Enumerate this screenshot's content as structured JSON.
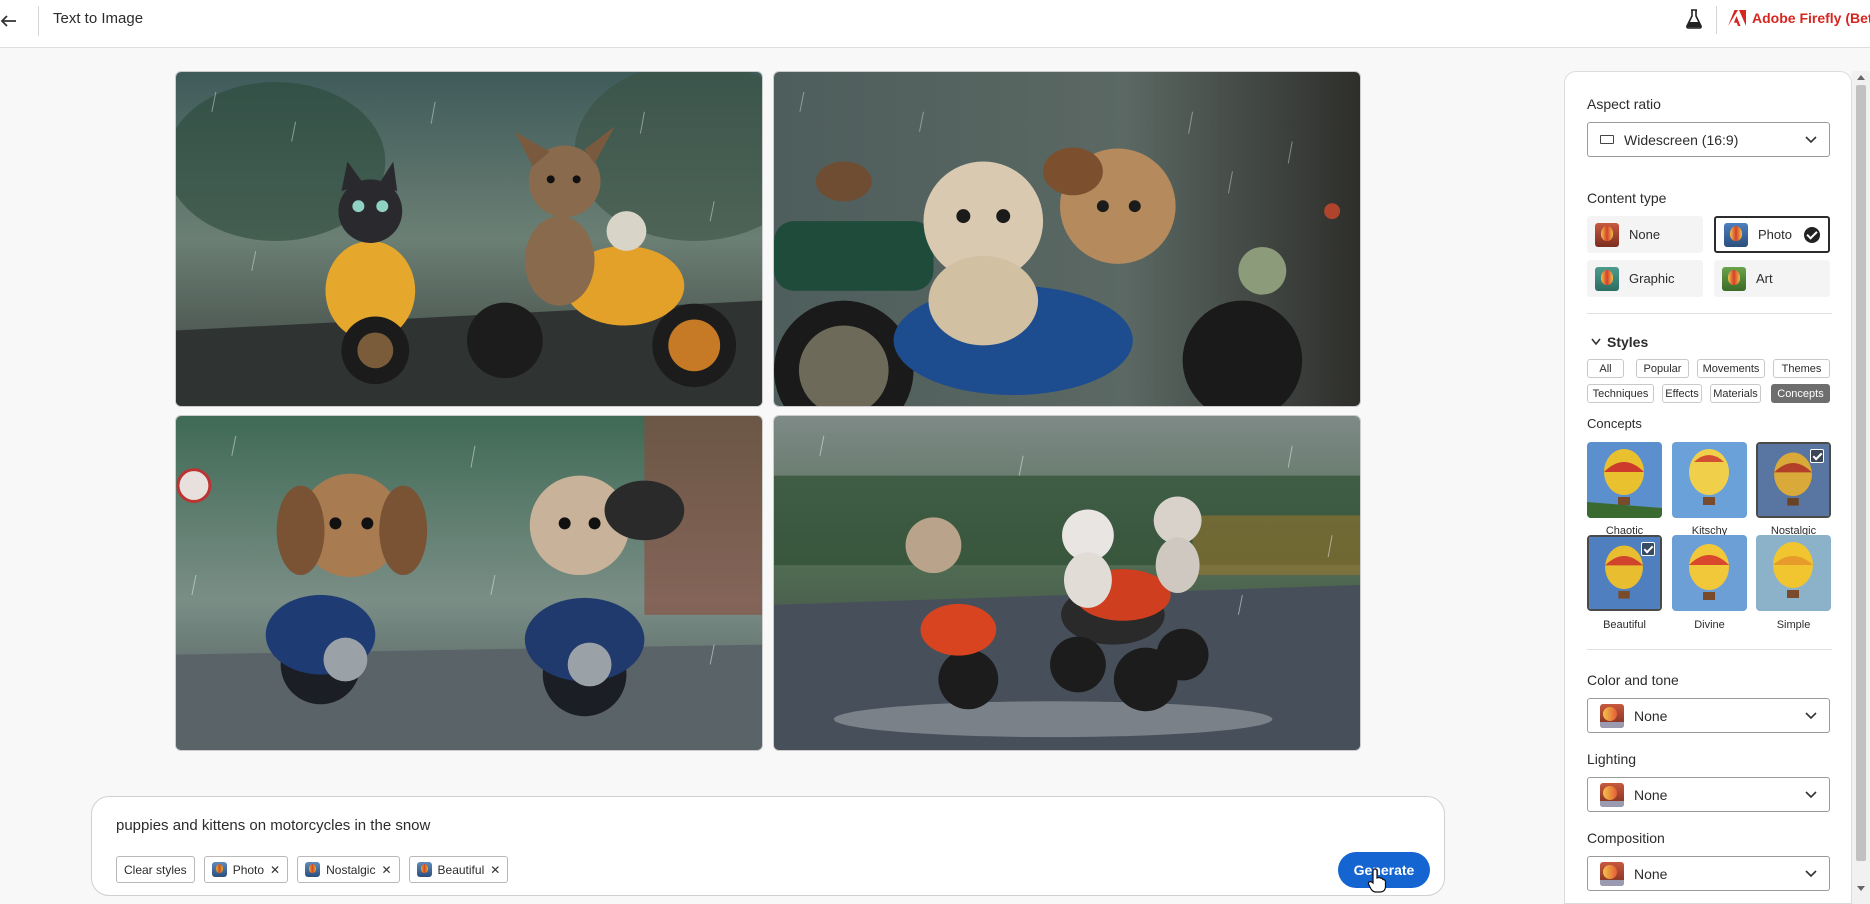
{
  "header": {
    "title": "Text to Image",
    "brand": "Adobe Firefly (Beta)"
  },
  "images": [
    {
      "alt": "kitten and puppy on yellow motorcycles in rain"
    },
    {
      "alt": "puppies on blue motorcycle in rain"
    },
    {
      "alt": "two puppies on blue motorcycles on wet road"
    },
    {
      "alt": "three kittens on red motorcycles on wet road"
    }
  ],
  "prompt": {
    "text": "puppies and kittens on motorcycles in the snow",
    "clear_label": "Clear styles",
    "chips": [
      "Photo",
      "Nostalgic",
      "Beautiful"
    ],
    "generate_label": "Generate"
  },
  "panel": {
    "aspect_ratio": {
      "label": "Aspect ratio",
      "value": "Widescreen (16:9)"
    },
    "content_type": {
      "label": "Content type",
      "options": [
        "None",
        "Photo",
        "Graphic",
        "Art"
      ],
      "selected": "Photo"
    },
    "styles": {
      "label": "Styles",
      "tags": [
        "All",
        "Popular",
        "Movements",
        "Themes",
        "Techniques",
        "Effects",
        "Materials",
        "Concepts"
      ],
      "active_tag": "Concepts"
    },
    "concepts": {
      "label": "Concepts",
      "items": [
        "Chaotic",
        "Kitschy",
        "Nostalgic",
        "Beautiful",
        "Divine",
        "Simple"
      ],
      "selected": [
        "Nostalgic",
        "Beautiful"
      ]
    },
    "color_tone": {
      "label": "Color and tone",
      "value": "None"
    },
    "lighting": {
      "label": "Lighting",
      "value": "None"
    },
    "composition": {
      "label": "Composition",
      "value": "None"
    }
  },
  "colors": {
    "brand": "#d7261f",
    "primary": "#1464d1"
  }
}
